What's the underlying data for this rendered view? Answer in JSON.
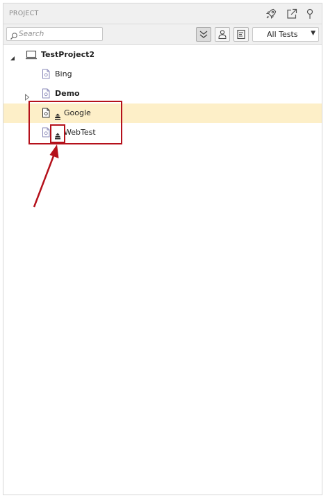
{
  "header": {
    "title": "PROJECT",
    "icons": [
      "rocket-icon",
      "external-link-icon",
      "pin-icon"
    ]
  },
  "toolbar": {
    "search_placeholder": "Search",
    "filter_selected": "All Tests",
    "buttons": [
      "collapse-all-icon",
      "user-icon",
      "document-list-icon"
    ]
  },
  "tree": {
    "project": {
      "label": "TestProject2",
      "expanded": true
    },
    "items": [
      {
        "label": "Bing",
        "bold": false,
        "expandable": false,
        "has_user_icon": false,
        "selected": false
      },
      {
        "label": "Demo",
        "bold": true,
        "expandable": true,
        "has_user_icon": false,
        "selected": false
      },
      {
        "label": "Google",
        "bold": false,
        "expandable": false,
        "has_user_icon": true,
        "selected": true
      },
      {
        "label": "WebTest",
        "bold": false,
        "expandable": false,
        "has_user_icon": true,
        "selected": false
      }
    ]
  },
  "colors": {
    "selection": "#fdefc8",
    "annotation": "#b5111b",
    "panel_header": "#f0f0f0"
  }
}
